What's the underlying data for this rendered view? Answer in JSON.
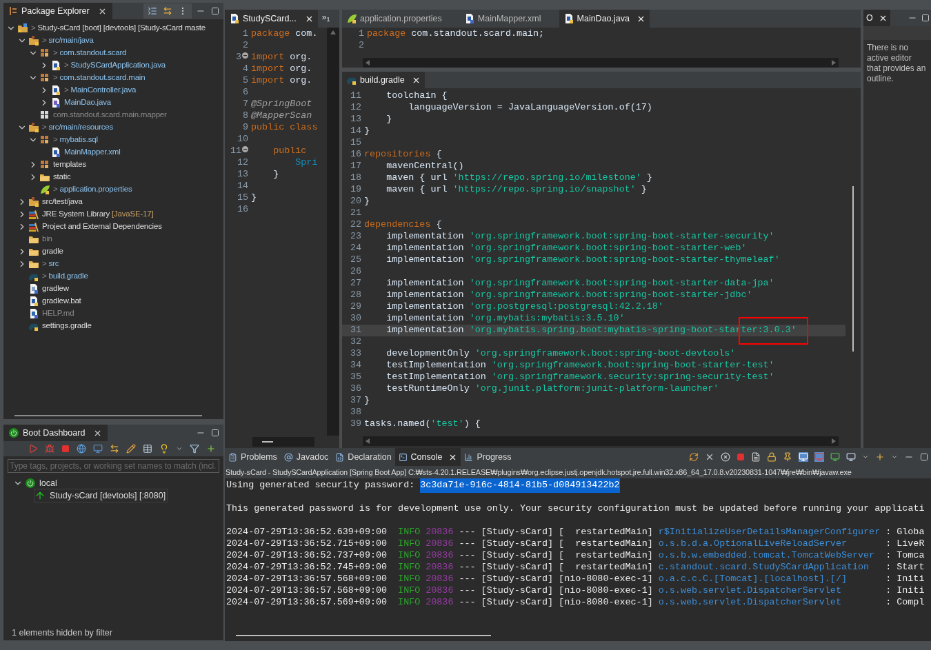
{
  "package_explorer": {
    "tab": {
      "label": "Package Explorer",
      "selected": true
    },
    "tree": [
      {
        "kind": "project",
        "prefix": ">",
        "label": "Study-sCard [boot] [devtools] [Study-sCard maste",
        "changed": false,
        "dimmed": false,
        "expanded": true,
        "children": [
          {
            "kind": "source-folder",
            "prefix": ">",
            "label": "src/main/java",
            "changed": true,
            "dimmed": false,
            "expanded": true,
            "children": [
              {
                "kind": "package",
                "prefix": ">",
                "label": "com.standout.scard",
                "changed": true,
                "dimmed": false,
                "expanded": true,
                "children": [
                  {
                    "kind": "java",
                    "prefix": ">",
                    "label": "StudySCardApplication.java",
                    "changed": true,
                    "dimmed": false,
                    "expanded": false
                  }
                ]
              },
              {
                "kind": "package",
                "prefix": ">",
                "label": "com.standout.scard.main",
                "changed": true,
                "dimmed": false,
                "expanded": true,
                "children": [
                  {
                    "kind": "java",
                    "prefix": ">",
                    "label": "MainController.java",
                    "changed": true,
                    "dimmed": false,
                    "expanded": false
                  },
                  {
                    "kind": "interface",
                    "label": "MainDao.java",
                    "changed": true,
                    "dimmed": false,
                    "expanded": false
                  }
                ]
              },
              {
                "kind": "empty-package",
                "label": "com.standout.scard.main.mapper",
                "changed": false,
                "dimmed": true
              }
            ]
          },
          {
            "kind": "source-folder",
            "prefix": ">",
            "label": "src/main/resources",
            "changed": true,
            "dimmed": false,
            "expanded": true,
            "children": [
              {
                "kind": "package",
                "prefix": ">",
                "label": "mybatis.sql",
                "changed": true,
                "dimmed": false,
                "expanded": true,
                "children": [
                  {
                    "kind": "xml",
                    "label": "MainMapper.xml",
                    "changed": true,
                    "dimmed": false
                  }
                ]
              },
              {
                "kind": "package",
                "label": "templates",
                "changed": false,
                "dimmed": false,
                "expanded": false
              },
              {
                "kind": "folder",
                "label": "static",
                "changed": false,
                "dimmed": false,
                "expanded": false
              },
              {
                "kind": "properties",
                "prefix": ">",
                "label": "application.properties",
                "changed": true,
                "dimmed": false
              }
            ]
          },
          {
            "kind": "source-folder",
            "label": "src/test/java",
            "changed": false,
            "dimmed": false,
            "expanded": false
          },
          {
            "kind": "library",
            "label": "JRE System Library",
            "suffix": "[JavaSE-17]",
            "changed": false,
            "dimmed": false,
            "expanded": false
          },
          {
            "kind": "library",
            "label": "Project and External Dependencies",
            "changed": false,
            "dimmed": false,
            "expanded": false
          },
          {
            "kind": "folder",
            "label": "bin",
            "changed": false,
            "dimmed": true
          },
          {
            "kind": "folder",
            "label": "gradle",
            "changed": false,
            "dimmed": false,
            "expanded": false
          },
          {
            "kind": "folder",
            "prefix": ">",
            "label": "src",
            "changed": true,
            "dimmed": false,
            "expanded": false
          },
          {
            "kind": "gradle",
            "prefix": ">",
            "label": "build.gradle",
            "changed": true,
            "dimmed": false
          },
          {
            "kind": "file",
            "label": "gradlew",
            "changed": false,
            "dimmed": false
          },
          {
            "kind": "bat",
            "label": "gradlew.bat",
            "changed": false,
            "dimmed": false
          },
          {
            "kind": "doc",
            "label": "HELP.md",
            "changed": false,
            "dimmed": true
          },
          {
            "kind": "gradle",
            "label": "settings.gradle",
            "changed": false,
            "dimmed": false
          }
        ]
      }
    ]
  },
  "boot_dashboard": {
    "tab": {
      "label": "Boot Dashboard",
      "selected": true
    },
    "filter": {
      "placeholder": "Type tags, projects, or working set names to match (incl."
    },
    "tree": [
      {
        "label": "local",
        "expanded": true,
        "children": [
          {
            "label": "Study-sCard [devtools] [:8080]"
          }
        ]
      }
    ],
    "status": "1 elements hidden by filter"
  },
  "side_editor": {
    "tabs": [
      {
        "label": "StudySCard...",
        "selected": true
      }
    ],
    "overflow": "»",
    "overflow_count": "1",
    "lines": [
      {
        "num": "1",
        "tokens": [
          {
            "kind": "keyword",
            "text": "package"
          },
          {
            "kind": "plain",
            "text": " com."
          }
        ]
      },
      {
        "num": "2"
      },
      {
        "num": "3",
        "fold": true,
        "tokens": [
          {
            "kind": "keyword",
            "text": "import"
          },
          {
            "kind": "plain",
            "text": " org."
          }
        ]
      },
      {
        "num": "4",
        "tokens": [
          {
            "kind": "keyword",
            "text": "import"
          },
          {
            "kind": "plain",
            "text": " org."
          }
        ]
      },
      {
        "num": "5",
        "tokens": [
          {
            "kind": "keyword",
            "text": "import"
          },
          {
            "kind": "plain",
            "text": " org."
          }
        ]
      },
      {
        "num": "6"
      },
      {
        "num": "7",
        "tokens": [
          {
            "kind": "annotation",
            "text": "@SpringBoot"
          }
        ]
      },
      {
        "num": "8",
        "tokens": [
          {
            "kind": "annotation",
            "text": "@MapperScan"
          }
        ]
      },
      {
        "num": "9",
        "tokens": [
          {
            "kind": "keyword",
            "text": "public class"
          }
        ]
      },
      {
        "num": "10"
      },
      {
        "num": "11",
        "fold": true,
        "tokens": [
          {
            "kind": "keyword",
            "text": "    public"
          }
        ]
      },
      {
        "num": "12",
        "tokens": [
          {
            "kind": "type",
            "text": "        Spri"
          }
        ]
      },
      {
        "num": "13",
        "tokens": [
          {
            "kind": "plain",
            "text": "    }"
          }
        ]
      },
      {
        "num": "14"
      },
      {
        "num": "15",
        "tokens": [
          {
            "kind": "plain",
            "text": "}"
          }
        ]
      },
      {
        "num": "16"
      }
    ]
  },
  "main_editor": {
    "tabs": [
      {
        "label": "application.properties",
        "kind": "properties",
        "selected": false
      },
      {
        "label": "MainMapper.xml",
        "kind": "xml",
        "selected": false
      },
      {
        "label": "MainDao.java",
        "kind": "java",
        "selected": true
      }
    ],
    "lines": [
      {
        "num": "1",
        "tokens": [
          {
            "kind": "keyword",
            "text": "package"
          },
          {
            "kind": "plain",
            "text": " com.standout.scard.main;"
          }
        ]
      },
      {
        "num": "2"
      }
    ]
  },
  "build_gradle": {
    "tab": {
      "label": "build.gradle",
      "selected": true
    },
    "lines": [
      {
        "num": "11",
        "current": false,
        "tokens": [
          {
            "kind": "plain",
            "text": "    toolchain {"
          }
        ]
      },
      {
        "num": "12",
        "current": false,
        "tokens": [
          {
            "kind": "plain",
            "text": "        languageVersion = JavaLanguageVersion.of(17)"
          }
        ]
      },
      {
        "num": "13",
        "current": false,
        "tokens": [
          {
            "kind": "plain",
            "text": "    }"
          }
        ]
      },
      {
        "num": "14",
        "current": false,
        "tokens": [
          {
            "kind": "plain",
            "text": "}"
          }
        ]
      },
      {
        "num": "15",
        "current": false
      },
      {
        "num": "16",
        "current": false,
        "tokens": [
          {
            "kind": "keyword",
            "text": "repositories"
          },
          {
            "kind": "plain",
            "text": " {"
          }
        ]
      },
      {
        "num": "17",
        "current": false,
        "tokens": [
          {
            "kind": "plain",
            "text": "    mavenCentral()"
          }
        ]
      },
      {
        "num": "18",
        "current": false,
        "tokens": [
          {
            "kind": "plain",
            "text": "    maven { url "
          },
          {
            "kind": "string",
            "text": "'https://repo.spring.io/milestone'"
          },
          {
            "kind": "plain",
            "text": " }"
          }
        ]
      },
      {
        "num": "19",
        "current": false,
        "tokens": [
          {
            "kind": "plain",
            "text": "    maven { url "
          },
          {
            "kind": "string",
            "text": "'https://repo.spring.io/snapshot'"
          },
          {
            "kind": "plain",
            "text": " }"
          }
        ]
      },
      {
        "num": "20",
        "current": false,
        "tokens": [
          {
            "kind": "plain",
            "text": "}"
          }
        ]
      },
      {
        "num": "21",
        "current": false
      },
      {
        "num": "22",
        "current": false,
        "tokens": [
          {
            "kind": "keyword",
            "text": "dependencies"
          },
          {
            "kind": "plain",
            "text": " {"
          }
        ]
      },
      {
        "num": "23",
        "current": false,
        "tokens": [
          {
            "kind": "plain",
            "text": "    implementation "
          },
          {
            "kind": "string",
            "text": "'org.springframework.boot:spring-boot-starter-security'"
          }
        ]
      },
      {
        "num": "24",
        "current": false,
        "tokens": [
          {
            "kind": "plain",
            "text": "    implementation "
          },
          {
            "kind": "string",
            "text": "'org.springframework.boot:spring-boot-starter-web'"
          }
        ]
      },
      {
        "num": "25",
        "current": false,
        "tokens": [
          {
            "kind": "plain",
            "text": "    implementation "
          },
          {
            "kind": "string",
            "text": "'org.springframework.boot:spring-boot-starter-thymeleaf'"
          }
        ]
      },
      {
        "num": "26",
        "current": false
      },
      {
        "num": "27",
        "current": false,
        "tokens": [
          {
            "kind": "plain",
            "text": "    implementation "
          },
          {
            "kind": "string",
            "text": "'org.springframework.boot:spring-boot-starter-data-jpa'"
          }
        ]
      },
      {
        "num": "28",
        "current": false,
        "tokens": [
          {
            "kind": "plain",
            "text": "    implementation "
          },
          {
            "kind": "string",
            "text": "'org.springframework.boot:spring-boot-starter-jdbc'"
          }
        ]
      },
      {
        "num": "29",
        "current": false,
        "tokens": [
          {
            "kind": "plain",
            "text": "    implementation "
          },
          {
            "kind": "string",
            "text": "'org.postgresql:postgresql:42.2.18'"
          }
        ]
      },
      {
        "num": "30",
        "current": false,
        "tokens": [
          {
            "kind": "plain",
            "text": "    implementation "
          },
          {
            "kind": "string",
            "text": "'org.mybatis:mybatis:3.5.10'"
          }
        ]
      },
      {
        "num": "31",
        "current": true,
        "tokens": [
          {
            "kind": "plain",
            "text": "    implementation "
          },
          {
            "kind": "string",
            "text": "'org.mybatis.spring.boot:mybatis-spring-boot-star"
          },
          {
            "kind": "marked-string",
            "text": "ter:3.0.3'"
          }
        ]
      },
      {
        "num": "32",
        "current": false
      },
      {
        "num": "33",
        "current": false,
        "tokens": [
          {
            "kind": "plain",
            "text": "    developmentOnly "
          },
          {
            "kind": "string",
            "text": "'org.springframework.boot:spring-boot-devtools'"
          }
        ]
      },
      {
        "num": "34",
        "current": false,
        "tokens": [
          {
            "kind": "plain",
            "text": "    testImplementation "
          },
          {
            "kind": "string",
            "text": "'org.springframework.boot:spring-boot-starter-test'"
          }
        ]
      },
      {
        "num": "35",
        "current": false,
        "tokens": [
          {
            "kind": "plain",
            "text": "    testImplementation "
          },
          {
            "kind": "string",
            "text": "'org.springframework.security:spring-security-test'"
          }
        ]
      },
      {
        "num": "36",
        "current": false,
        "tokens": [
          {
            "kind": "plain",
            "text": "    testRuntimeOnly "
          },
          {
            "kind": "string",
            "text": "'org.junit.platform:junit-platform-launcher'"
          }
        ]
      },
      {
        "num": "37",
        "current": false,
        "tokens": [
          {
            "kind": "plain",
            "text": "}"
          }
        ]
      },
      {
        "num": "38",
        "current": false
      },
      {
        "num": "39",
        "current": false,
        "tokens": [
          {
            "kind": "plain",
            "text": "tasks.named("
          },
          {
            "kind": "string",
            "text": "'test'"
          },
          {
            "kind": "plain",
            "text": ") {"
          }
        ]
      }
    ]
  },
  "outline": {
    "tab": {
      "label": "O",
      "selected": true
    },
    "message": "There is no active editor that provides an outline."
  },
  "console": {
    "tabs": [
      {
        "label": "Problems",
        "kind": "problems",
        "selected": false
      },
      {
        "label": "Javadoc",
        "kind": "javadoc",
        "selected": false
      },
      {
        "label": "Declaration",
        "kind": "declaration",
        "selected": false
      },
      {
        "label": "Console",
        "kind": "console",
        "selected": true
      },
      {
        "label": "Progress",
        "kind": "progress",
        "selected": false
      }
    ],
    "header": "Study-sCard - StudySCardApplication [Spring Boot App] C:₩sts-4.20.1.RELEASE₩plugins₩org.eclipse.justj.openjdk.hotspot.jre.full.win32.x86_64_17.0.8.v20230831-1047₩jre₩bin₩javaw.exe",
    "password_line": {
      "text": "Using generated security password: ",
      "selection": "3c3da71e-916c-4814-81b5-d084913422b2"
    },
    "warning": "This generated password is for development use only. Your security configuration must be updated before running your applicati",
    "rows": [
      {
        "kind": "info",
        "time": "2024-07-29T13:36:52.639+09:00",
        "level": "INFO",
        "pid": "20836",
        "sep": "---",
        "app": "[Study-sCard]",
        "thread": "[  restartedMain]",
        "logger": "r$InitializeUserDetailsManagerConfigurer",
        "message": ": Globa"
      },
      {
        "kind": "info",
        "time": "2024-07-29T13:36:52.715+09:00",
        "level": "INFO",
        "pid": "20836",
        "sep": "---",
        "app": "[Study-sCard]",
        "thread": "[  restartedMain]",
        "logger": "o.s.b.d.a.OptionalLiveReloadServer",
        "message": ": LiveR"
      },
      {
        "kind": "info",
        "time": "2024-07-29T13:36:52.737+09:00",
        "level": "INFO",
        "pid": "20836",
        "sep": "---",
        "app": "[Study-sCard]",
        "thread": "[  restartedMain]",
        "logger": "o.s.b.w.embedded.tomcat.TomcatWebServer",
        "message": ": Tomca"
      },
      {
        "kind": "info",
        "time": "2024-07-29T13:36:52.745+09:00",
        "level": "INFO",
        "pid": "20836",
        "sep": "---",
        "app": "[Study-sCard]",
        "thread": "[  restartedMain]",
        "logger": "c.standout.scard.StudySCardApplication",
        "message": ": Start"
      },
      {
        "kind": "info",
        "time": "2024-07-29T13:36:57.568+09:00",
        "level": "INFO",
        "pid": "20836",
        "sep": "---",
        "app": "[Study-sCard]",
        "thread": "[nio-8080-exec-1]",
        "logger": "o.a.c.c.C.[Tomcat].[localhost].[/]",
        "message": ": Initi"
      },
      {
        "kind": "info",
        "time": "2024-07-29T13:36:57.568+09:00",
        "level": "INFO",
        "pid": "20836",
        "sep": "---",
        "app": "[Study-sCard]",
        "thread": "[nio-8080-exec-1]",
        "logger": "o.s.web.servlet.DispatcherServlet",
        "message": ": Initi"
      },
      {
        "kind": "info",
        "time": "2024-07-29T13:36:57.569+09:00",
        "level": "INFO",
        "pid": "20836",
        "sep": "---",
        "app": "[Study-sCard]",
        "thread": "[nio-8080-exec-1]",
        "logger": "o.s.web.servlet.DispatcherServlet",
        "message": ": Compl"
      }
    ]
  }
}
